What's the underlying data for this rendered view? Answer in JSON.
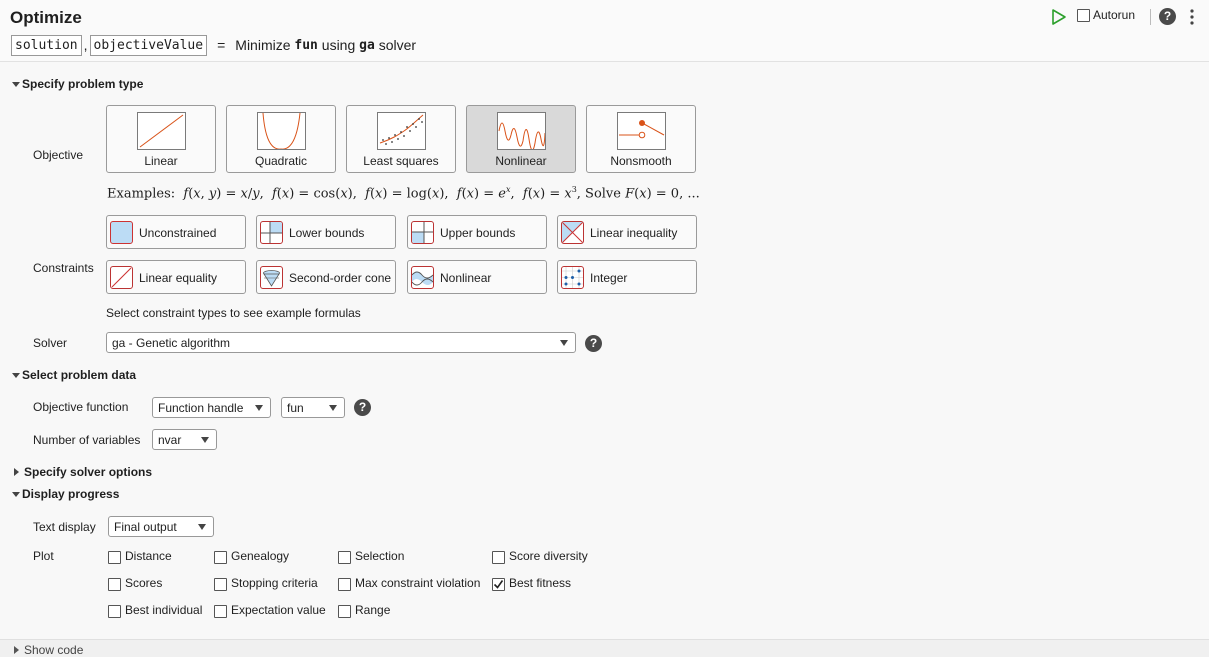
{
  "header": {
    "title": "Optimize",
    "outputs": [
      "solution",
      "objectiveValue"
    ],
    "comma": ",",
    "equals": "=",
    "summary_pre": "Minimize",
    "fun": "fun",
    "summary_mid": "using",
    "solver_name": "ga",
    "summary_post": "solver",
    "autorun_label": "Autorun",
    "autorun_checked": false,
    "run_icon": "play-icon",
    "help_icon": "help-icon",
    "help_glyph": "?",
    "menu_icon": "kebab-menu-icon"
  },
  "problem_type": {
    "header": "Specify problem type",
    "objective_label": "Objective",
    "objectives": [
      {
        "label": "Linear",
        "icon": "linear-plot-icon",
        "selected": false
      },
      {
        "label": "Quadratic",
        "icon": "quadratic-plot-icon",
        "selected": false
      },
      {
        "label": "Least squares",
        "icon": "least-squares-plot-icon",
        "selected": false
      },
      {
        "label": "Nonlinear",
        "icon": "nonlinear-plot-icon",
        "selected": true
      },
      {
        "label": "Nonsmooth",
        "icon": "nonsmooth-plot-icon",
        "selected": false
      }
    ],
    "examples_prefix": "Examples:",
    "examples_suffix": "Solve",
    "examples_end": "...",
    "constraints_label": "Constraints",
    "constraints": [
      {
        "label": "Unconstrained",
        "icon": "unconstrained-icon"
      },
      {
        "label": "Lower bounds",
        "icon": "lower-bounds-icon"
      },
      {
        "label": "Upper bounds",
        "icon": "upper-bounds-icon"
      },
      {
        "label": "Linear inequality",
        "icon": "linear-inequality-icon"
      },
      {
        "label": "Linear equality",
        "icon": "linear-equality-icon"
      },
      {
        "label": "Second-order cone",
        "icon": "second-order-cone-icon"
      },
      {
        "label": "Nonlinear",
        "icon": "nonlinear-constraint-icon"
      },
      {
        "label": "Integer",
        "icon": "integer-icon"
      }
    ],
    "constraints_hint": "Select constraint types to see example formulas",
    "solver_label": "Solver",
    "solver_value": "ga - Genetic algorithm"
  },
  "problem_data": {
    "header": "Select problem data",
    "objective_function_label": "Objective function",
    "objective_type_value": "Function handle",
    "objective_fun_value": "fun",
    "num_vars_label": "Number of variables",
    "num_vars_value": "nvar"
  },
  "solver_options": {
    "header": "Specify solver options"
  },
  "display_progress": {
    "header": "Display progress",
    "text_display_label": "Text display",
    "text_display_value": "Final output",
    "plot_label": "Plot",
    "plots": [
      {
        "label": "Distance",
        "checked": false
      },
      {
        "label": "Genealogy",
        "checked": false
      },
      {
        "label": "Selection",
        "checked": false
      },
      {
        "label": "Score diversity",
        "checked": false
      },
      {
        "label": "Scores",
        "checked": false
      },
      {
        "label": "Stopping criteria",
        "checked": false
      },
      {
        "label": "Max constraint violation",
        "checked": false
      },
      {
        "label": "Best fitness",
        "checked": true
      },
      {
        "label": "Best individual",
        "checked": false
      },
      {
        "label": "Expectation value",
        "checked": false
      },
      {
        "label": "Range",
        "checked": false
      }
    ]
  },
  "footer": {
    "show_code": "Show code"
  },
  "colors": {
    "accent_orange": "#d95319",
    "run_green": "#2ca02c",
    "selected_bg": "#d9d9d9",
    "constraint_fill": "#bcdcf5"
  }
}
